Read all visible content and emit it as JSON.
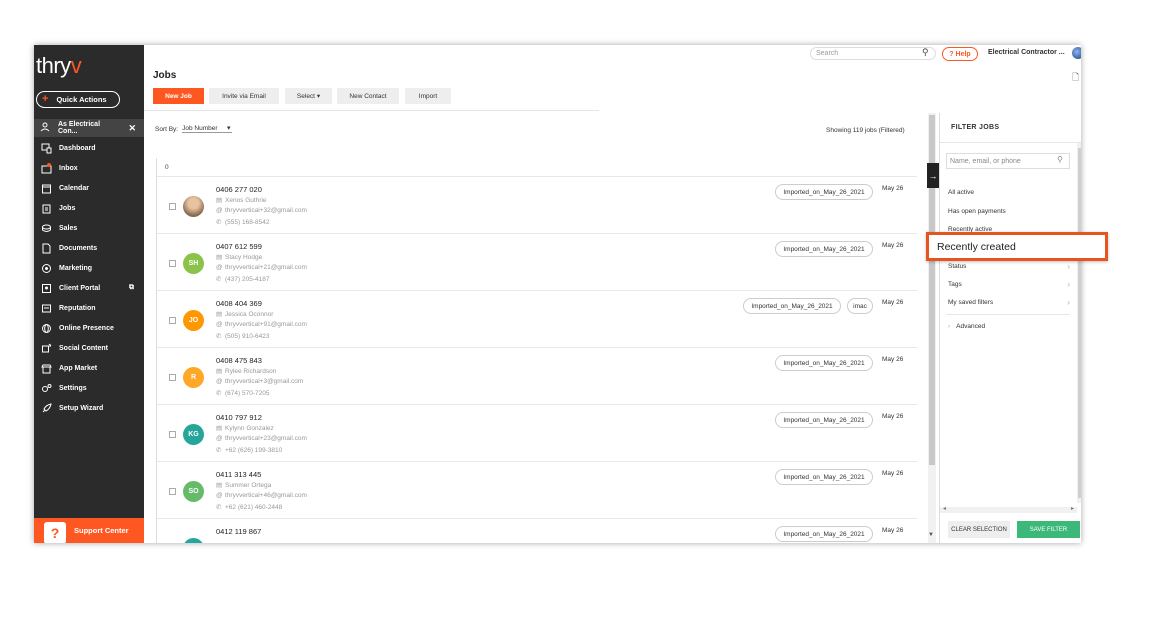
{
  "sidebar": {
    "logo": {
      "main": "thry",
      "accent": "v"
    },
    "quick_actions": "Quick Actions",
    "account": "As Electrical Con...",
    "items": [
      {
        "label": "Dashboard",
        "icon": "dashboard-icon"
      },
      {
        "label": "Inbox",
        "icon": "inbox-icon"
      },
      {
        "label": "Calendar",
        "icon": "calendar-icon"
      },
      {
        "label": "Jobs",
        "icon": "jobs-icon"
      },
      {
        "label": "Sales",
        "icon": "sales-icon"
      },
      {
        "label": "Documents",
        "icon": "documents-icon"
      },
      {
        "label": "Marketing",
        "icon": "marketing-icon"
      },
      {
        "label": "Client Portal",
        "icon": "client-portal-icon"
      },
      {
        "label": "Reputation",
        "icon": "reputation-icon"
      },
      {
        "label": "Online Presence",
        "icon": "globe-icon"
      },
      {
        "label": "Social Content",
        "icon": "social-icon"
      },
      {
        "label": "App Market",
        "icon": "app-market-icon"
      },
      {
        "label": "Settings",
        "icon": "settings-icon"
      },
      {
        "label": "Setup Wizard",
        "icon": "rocket-icon"
      }
    ],
    "support": "Support Center",
    "support_icon": "?"
  },
  "header": {
    "search_placeholder": "Search",
    "help": "? Help",
    "account_name": "Electrical Contractor ..."
  },
  "page": {
    "title": "Jobs",
    "toolbar": {
      "new_job": "New Job",
      "invite": "Invite via Email",
      "select": "Select",
      "new_contact": "New Contact",
      "import": "Import"
    },
    "sort_label": "Sort By:",
    "sort_value": "Job Number",
    "showing": "Showing 119 jobs (Filtered)",
    "group_header": "0"
  },
  "jobs": [
    {
      "phone": "0406 277 020",
      "name": "Xenos Guthrie",
      "email": "thryvvertical+32@gmail.com",
      "tel": "(555) 168-8542",
      "initials": "",
      "avatar_color": "#b08a6a",
      "tags": [
        "Imported_on_May_26_2021"
      ],
      "date": "May 26"
    },
    {
      "phone": "0407 612 599",
      "name": "Stacy Hodge",
      "email": "thryvvertical+21@gmail.com",
      "tel": "(437) 205-4187",
      "initials": "SH",
      "avatar_color": "#8bc34a",
      "tags": [
        "Imported_on_May_26_2021"
      ],
      "date": "May 26"
    },
    {
      "phone": "0408 404 369",
      "name": "Jessica Oconnor",
      "email": "thryvvertical+91@gmail.com",
      "tel": "(505) 910-6423",
      "initials": "JO",
      "avatar_color": "#ff9800",
      "tags": [
        "Imported_on_May_26_2021",
        "imac"
      ],
      "date": "May 26"
    },
    {
      "phone": "0408 475 843",
      "name": "Rylee Richardson",
      "email": "thryvvertical+3@gmail.com",
      "tel": "(674) 570-7205",
      "initials": "R",
      "avatar_color": "#ffa726",
      "tags": [
        "Imported_on_May_26_2021"
      ],
      "date": "May 26"
    },
    {
      "phone": "0410 797 912",
      "name": "Kylynn Gonzalez",
      "email": "thryvvertical+23@gmail.com",
      "tel": "+62 (626) 199-3810",
      "initials": "KG",
      "avatar_color": "#26a69a",
      "tags": [
        "Imported_on_May_26_2021"
      ],
      "date": "May 26"
    },
    {
      "phone": "0411 313 445",
      "name": "Summer Ortega",
      "email": "thryvvertical+46@gmail.com",
      "tel": "+62 (621) 460-2448",
      "initials": "SO",
      "avatar_color": "#66bb6a",
      "tags": [
        "Imported_on_May_26_2021"
      ],
      "date": "May 26"
    },
    {
      "phone": "0412 119 867",
      "name": "",
      "email": "",
      "tel": "",
      "initials": "",
      "avatar_color": "#26a69a",
      "tags": [
        "Imported_on_May_26_2021"
      ],
      "date": "May 26"
    }
  ],
  "filter": {
    "title": "FILTER JOBS",
    "search_placeholder": "Name, email, or phone",
    "options": [
      "All active",
      "Has open payments",
      "Recently active"
    ],
    "expandable": [
      "Status",
      "Tags",
      "My saved filters"
    ],
    "advanced": "Advanced",
    "clear": "CLEAR SELECTION",
    "save": "SAVE FILTER"
  },
  "highlight": {
    "label": "Recently created",
    "color": "#e8541f"
  },
  "colors": {
    "accent": "#ff5722",
    "sidebar": "#2b2b2b",
    "save": "#3cb878"
  }
}
